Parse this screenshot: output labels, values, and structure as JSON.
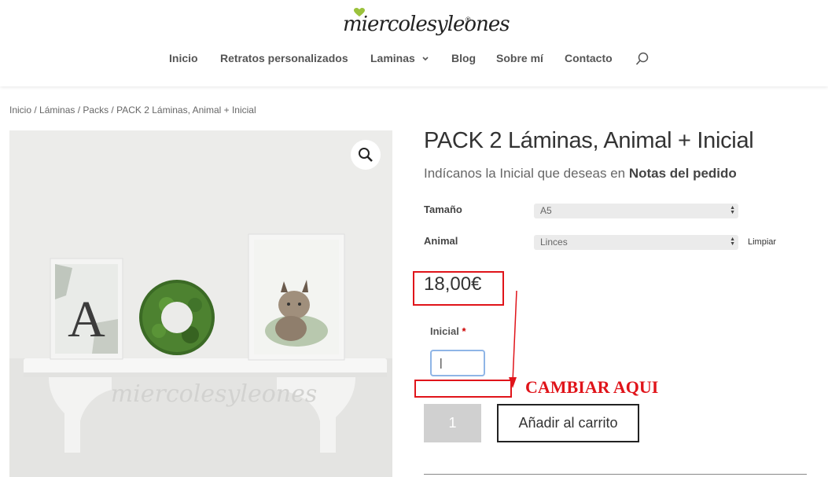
{
  "header": {
    "logo_text": "miercolesyleones",
    "logo_reg": "®",
    "nav": [
      {
        "label": "Inicio"
      },
      {
        "label": "Retratos personalizados"
      },
      {
        "label": "Laminas"
      },
      {
        "label": "Blog"
      },
      {
        "label": "Sobre mí"
      },
      {
        "label": "Contacto"
      }
    ],
    "search_icon": "search-icon"
  },
  "breadcrumb": {
    "items": [
      "Inicio",
      "Láminas",
      "Packs",
      "PACK 2 Láminas, Animal + Inicial"
    ],
    "separator": " / "
  },
  "product_image": {
    "zoom_icon": "magnifier-icon",
    "watermark": "miercolesyleones",
    "letter": "A"
  },
  "product": {
    "title": "PACK 2 Láminas, Animal + Inicial",
    "subtitle_prefix": "Indícanos la Inicial que deseas en ",
    "subtitle_bold": "Notas del pedido",
    "variations": [
      {
        "label": "Tamaño",
        "value": "A5"
      },
      {
        "label": "Animal",
        "value": "Linces"
      }
    ],
    "clear_label": "Limpiar",
    "price": "18,00€",
    "initial_label": "Inicial",
    "required_mark": "*",
    "initial_value": "|",
    "quantity": "1",
    "add_to_cart": "Añadir al carrito"
  },
  "annotation": {
    "text": "CAMBIAR AQUI",
    "color": "#e0141a"
  }
}
